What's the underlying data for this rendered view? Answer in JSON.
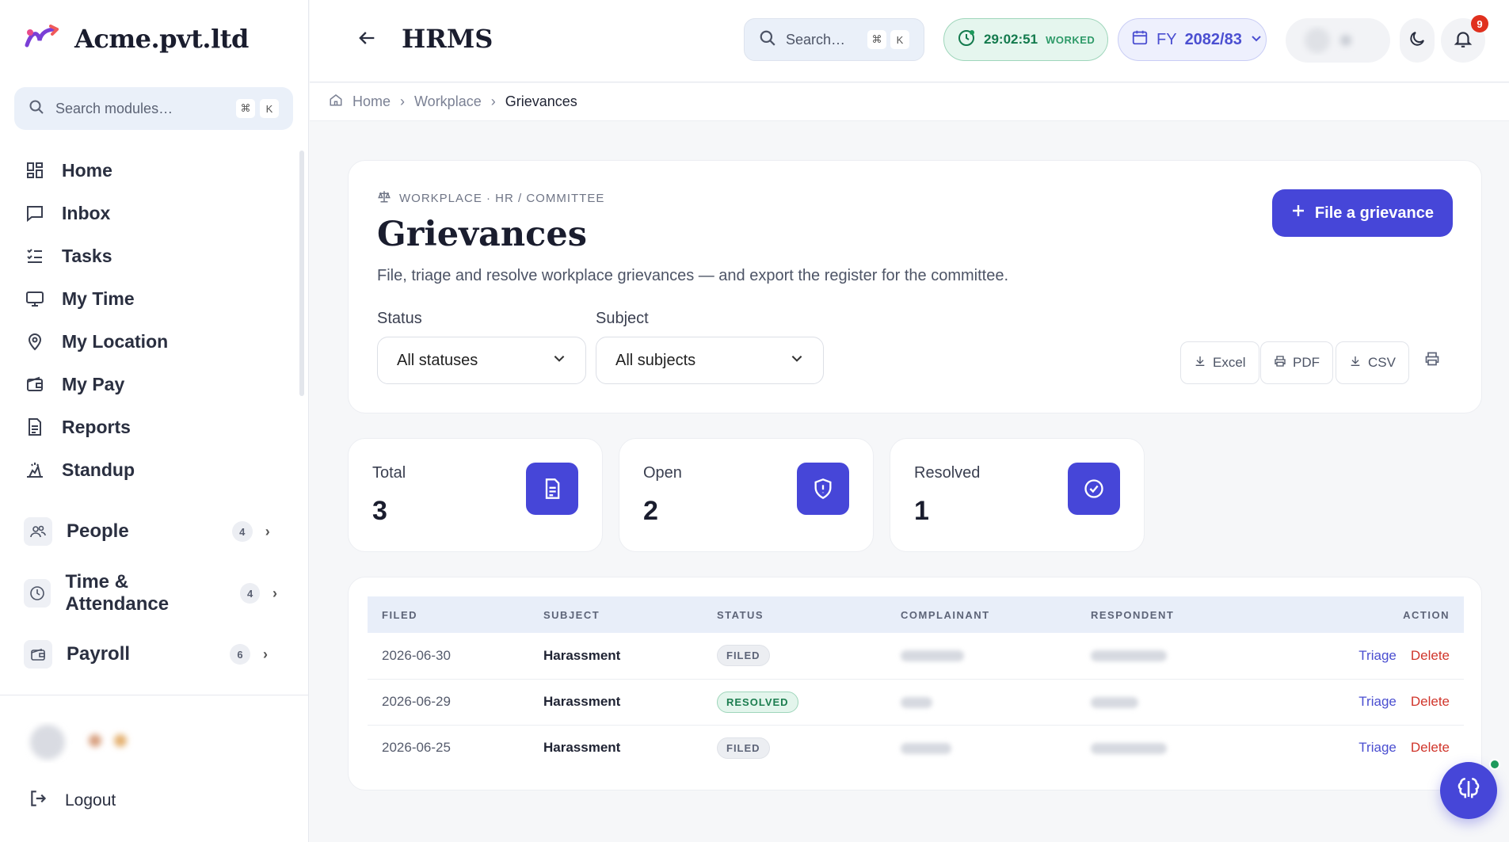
{
  "brand": {
    "name": "Acme.pvt.ltd"
  },
  "sidebar": {
    "search_placeholder": "Search modules…",
    "kbd_cmd": "⌘",
    "kbd_k": "K",
    "items": [
      {
        "label": "Home",
        "icon": "grid-icon"
      },
      {
        "label": "Inbox",
        "icon": "message-icon"
      },
      {
        "label": "Tasks",
        "icon": "checklist-icon"
      },
      {
        "label": "My Time",
        "icon": "monitor-icon"
      },
      {
        "label": "My Location",
        "icon": "map-pin-icon"
      },
      {
        "label": "My Pay",
        "icon": "wallet-icon"
      },
      {
        "label": "Reports",
        "icon": "document-icon"
      },
      {
        "label": "Standup",
        "icon": "standup-icon"
      }
    ],
    "groups": [
      {
        "label": "People",
        "count": "4"
      },
      {
        "label": "Time & Attendance",
        "count": "4"
      },
      {
        "label": "Payroll",
        "count": "6"
      }
    ],
    "logout": "Logout"
  },
  "topbar": {
    "title": "HRMS",
    "search_placeholder": "Search…",
    "kbd_cmd": "⌘",
    "kbd_k": "K",
    "timer": "29:02:51",
    "timer_label": "WORKED",
    "fy_prefix": "FY",
    "fy_value": "2082/83",
    "notification_count": "9"
  },
  "breadcrumb": {
    "home": "Home",
    "section": "Workplace",
    "current": "Grievances"
  },
  "page": {
    "eyebrow": "WORKPLACE · HR / COMMITTEE",
    "title": "Grievances",
    "subtitle": "File, triage and resolve workplace grievances — and export the register for the committee.",
    "primary_action": "File a grievance",
    "filters": {
      "status_label": "Status",
      "status_value": "All statuses",
      "subject_label": "Subject",
      "subject_value": "All subjects"
    },
    "exports": {
      "excel": "Excel",
      "pdf": "PDF",
      "csv": "CSV"
    }
  },
  "stats": [
    {
      "label": "Total",
      "value": "3",
      "icon": "document-icon"
    },
    {
      "label": "Open",
      "value": "2",
      "icon": "shield-alert-icon"
    },
    {
      "label": "Resolved",
      "value": "1",
      "icon": "check-circle-icon"
    }
  ],
  "table": {
    "columns": {
      "filed": "FILED",
      "subject": "SUBJECT",
      "status": "STATUS",
      "complainant": "COMPLAINANT",
      "respondent": "RESPONDENT",
      "action": "ACTION"
    },
    "rows": [
      {
        "filed": "2026-06-30",
        "subject": "Harassment",
        "status": "FILED",
        "status_kind": "filed"
      },
      {
        "filed": "2026-06-29",
        "subject": "Harassment",
        "status": "RESOLVED",
        "status_kind": "resolved"
      },
      {
        "filed": "2026-06-25",
        "subject": "Harassment",
        "status": "FILED",
        "status_kind": "filed"
      }
    ],
    "triage_label": "Triage",
    "delete_label": "Delete"
  },
  "colors": {
    "accent": "#4646d8",
    "success": "#1c7d4f",
    "danger": "#d0352b"
  }
}
